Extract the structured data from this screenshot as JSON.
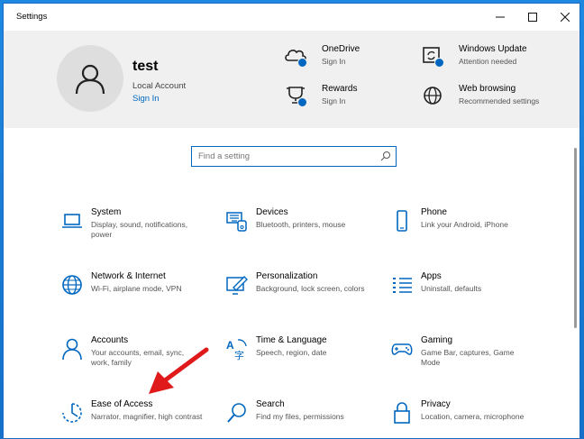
{
  "window": {
    "title": "Settings"
  },
  "user": {
    "name": "test",
    "account_type": "Local Account",
    "sign_in_label": "Sign In"
  },
  "services": [
    {
      "title": "OneDrive",
      "subtitle": "Sign In",
      "icon": "cloud-icon"
    },
    {
      "title": "Windows Update",
      "subtitle": "Attention needed",
      "icon": "update-icon"
    },
    {
      "title": "Rewards",
      "subtitle": "Sign In",
      "icon": "trophy-icon"
    },
    {
      "title": "Web browsing",
      "subtitle": "Recommended settings",
      "icon": "globe-icon"
    }
  ],
  "search": {
    "placeholder": "Find a setting"
  },
  "categories": [
    {
      "title": "System",
      "desc": "Display, sound, notifications, power",
      "icon": "laptop-icon"
    },
    {
      "title": "Devices",
      "desc": "Bluetooth, printers, mouse",
      "icon": "keyboard-icon"
    },
    {
      "title": "Phone",
      "desc": "Link your Android, iPhone",
      "icon": "phone-icon"
    },
    {
      "title": "Network & Internet",
      "desc": "Wi-Fi, airplane mode, VPN",
      "icon": "network-globe-icon"
    },
    {
      "title": "Personalization",
      "desc": "Background, lock screen, colors",
      "icon": "paint-icon"
    },
    {
      "title": "Apps",
      "desc": "Uninstall, defaults",
      "icon": "apps-list-icon"
    },
    {
      "title": "Accounts",
      "desc": "Your accounts, email, sync, work, family",
      "icon": "person-icon"
    },
    {
      "title": "Time & Language",
      "desc": "Speech, region, date",
      "icon": "time-language-icon"
    },
    {
      "title": "Gaming",
      "desc": "Game Bar, captures, Game Mode",
      "icon": "gamepad-icon"
    },
    {
      "title": "Ease of Access",
      "desc": "Narrator, magnifier, high contrast",
      "icon": "ease-of-access-icon"
    },
    {
      "title": "Search",
      "desc": "Find my files, permissions",
      "icon": "search-icon"
    },
    {
      "title": "Privacy",
      "desc": "Location, camera, microphone",
      "icon": "lock-icon"
    }
  ],
  "colors": {
    "accent": "#0067c0",
    "arrow": "#e0191b",
    "header_bg": "#f0f0f0"
  }
}
